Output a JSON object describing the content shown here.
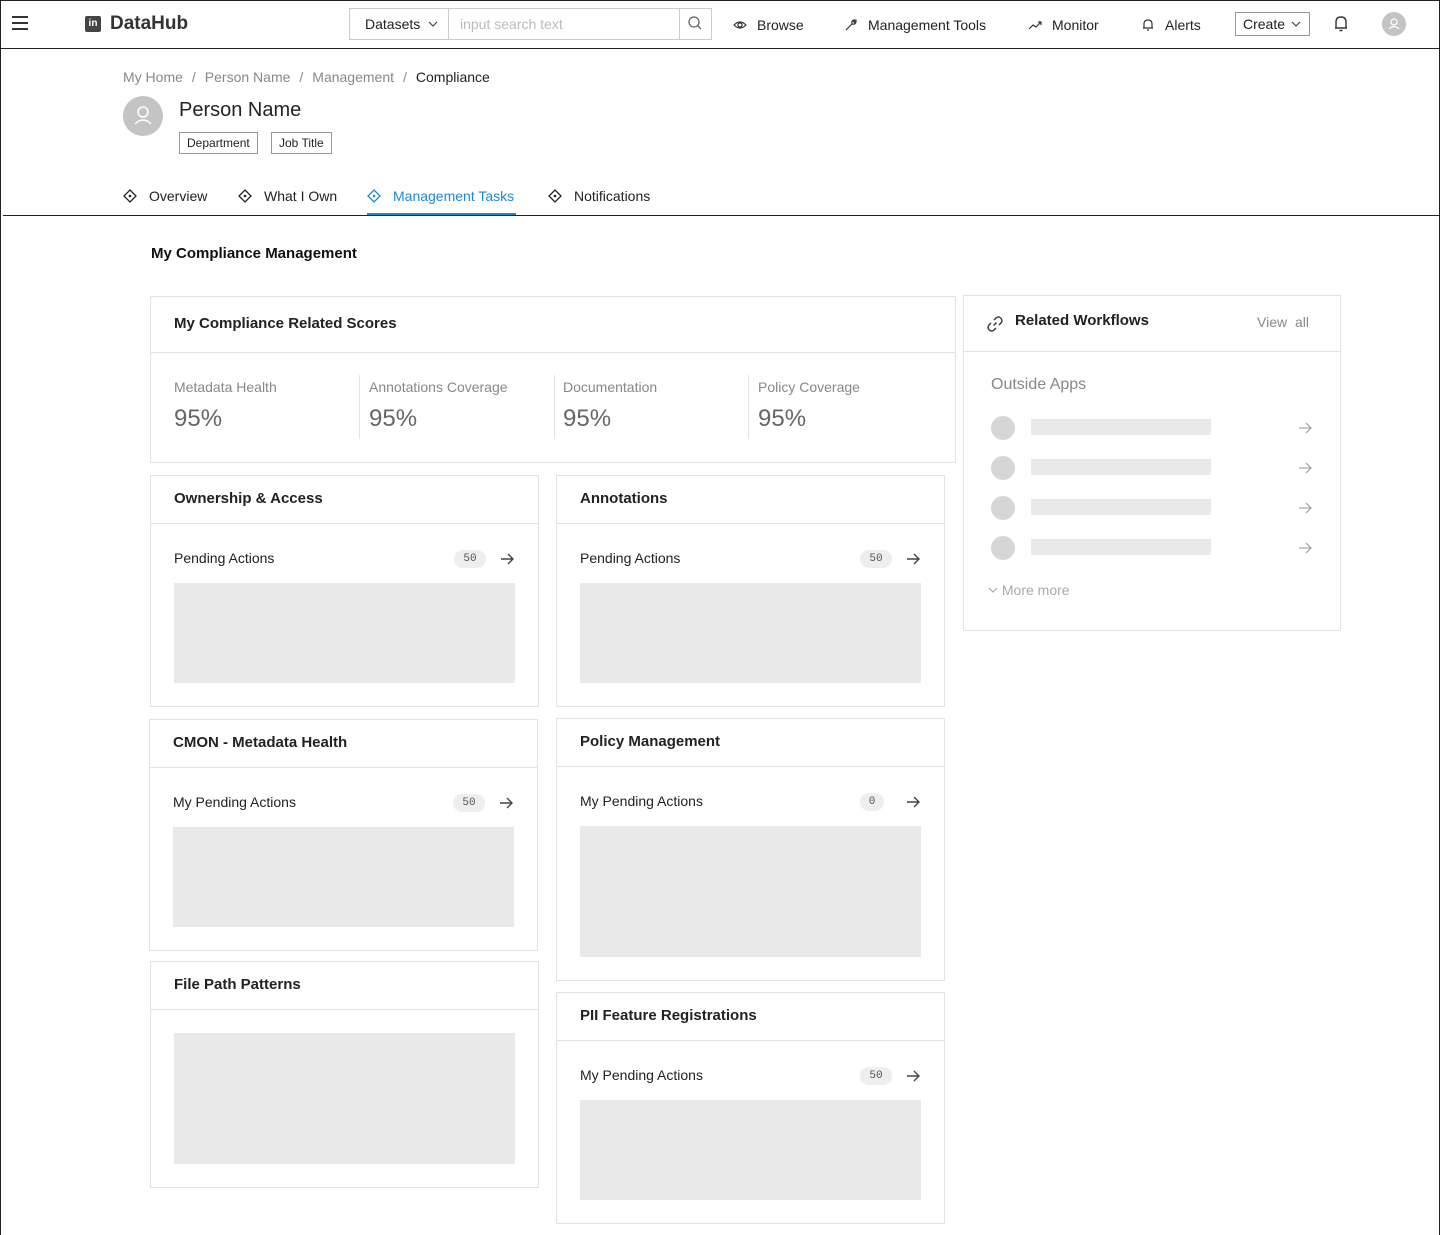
{
  "app": {
    "name": "DataHub",
    "logo_text": "in"
  },
  "search": {
    "type_selected": "Datasets",
    "placeholder": "input search text"
  },
  "nav": {
    "browse": "Browse",
    "management_tools": "Management Tools",
    "monitor": "Monitor",
    "alerts": "Alerts",
    "create": "Create"
  },
  "breadcrumb": [
    "My Home",
    "Person Name",
    "Management",
    "Compliance"
  ],
  "profile": {
    "name": "Person Name",
    "tags": [
      "Department",
      "Job Title"
    ]
  },
  "tabs": [
    "Overview",
    "What I Own",
    "Management Tasks",
    "Notifications"
  ],
  "active_tab": "Management Tasks",
  "section_title": "My Compliance Management",
  "scores": {
    "title": "My Compliance Related Scores",
    "items": [
      {
        "label": "Metadata Health",
        "value": "95%"
      },
      {
        "label": "Annotations Coverage",
        "value": "95%"
      },
      {
        "label": "Documentation",
        "value": "95%"
      },
      {
        "label": "Policy Coverage",
        "value": "95%"
      }
    ]
  },
  "cards": {
    "ownership": {
      "title": "Ownership & Access",
      "pending": "Pending Actions",
      "count": "50"
    },
    "annotations": {
      "title": "Annotations",
      "pending": "Pending Actions",
      "count": "50"
    },
    "cmon": {
      "title": "CMON - Metadata Health",
      "pending": "My Pending Actions",
      "count": "50"
    },
    "policy": {
      "title": "Policy Management",
      "pending": "My Pending Actions",
      "count": "0"
    },
    "filepath": {
      "title": "File Path Patterns"
    },
    "pii": {
      "title": "PII Feature Registrations",
      "pending": "My Pending Actions",
      "count": "50"
    }
  },
  "workflows": {
    "title": "Related Workflows",
    "view_all": "View all",
    "group": "Outside Apps",
    "more": "More more"
  },
  "colors": {
    "accent": "#1a8ad6",
    "placeholder": "#e9e9e9",
    "border": "#e2e2e2"
  }
}
